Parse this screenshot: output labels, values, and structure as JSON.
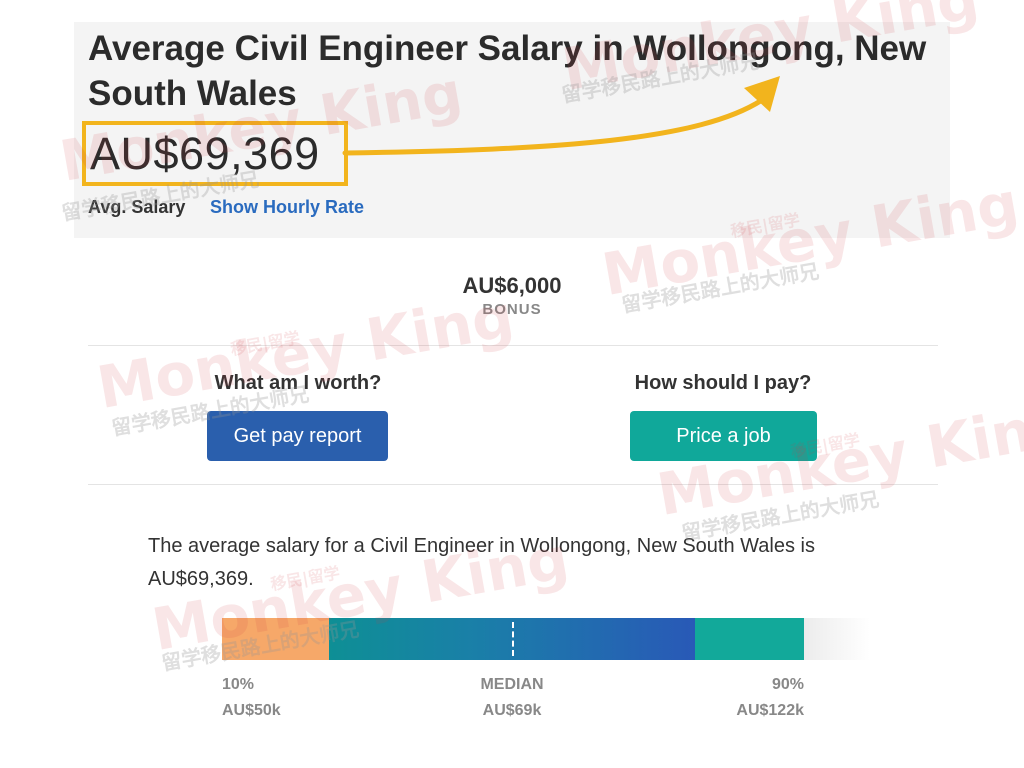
{
  "header": {
    "title": "Average Civil Engineer Salary in Wollongong, New South Wales",
    "salary": "AU$69,369",
    "avg_label": "Avg. Salary",
    "hourly_link": "Show Hourly Rate"
  },
  "bonus": {
    "value": "AU$6,000",
    "label": "BONUS"
  },
  "cta": {
    "left": {
      "heading": "What am I worth?",
      "button": "Get pay report"
    },
    "right": {
      "heading": "How should I pay?",
      "button": "Price a job"
    }
  },
  "summary": "The average salary for a Civil Engineer in Wollongong, New South Wales is AU$69,369.",
  "range": {
    "low": {
      "percentile": "10%",
      "value": "AU$50k"
    },
    "median": {
      "label": "MEDIAN",
      "value": "AU$69k"
    },
    "high": {
      "percentile": "90%",
      "value": "AU$122k"
    }
  },
  "watermark": {
    "text": "Monkey King",
    "sub": "留学移民路上的大师兄",
    "badge": "移民|留学"
  },
  "colors": {
    "highlight": "#f2b41d",
    "link": "#2a6bbf",
    "button_blue": "#2a5fad",
    "button_teal": "#10a89a",
    "bar_orange": "#f6a869",
    "bar_teal": "#12a99a"
  }
}
